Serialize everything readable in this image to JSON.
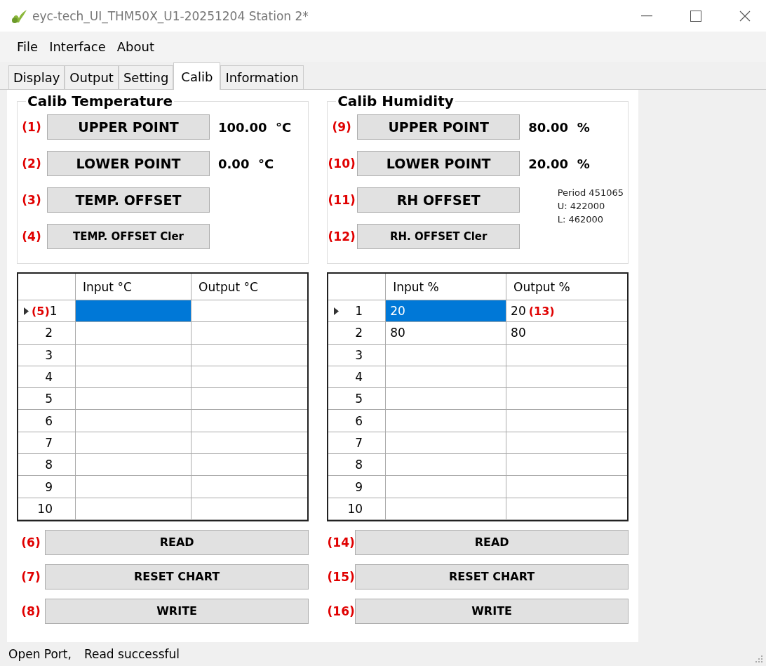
{
  "window": {
    "title": "eyc-tech_UI_THM50X_U1-20251204  Station 2*"
  },
  "menu": [
    {
      "label": "File"
    },
    {
      "label": "Interface"
    },
    {
      "label": "About"
    }
  ],
  "tabs": [
    {
      "label": "Display",
      "selected": false
    },
    {
      "label": "Output",
      "selected": false
    },
    {
      "label": "Setting",
      "selected": false
    },
    {
      "label": "Calib",
      "selected": true
    },
    {
      "label": "Information",
      "selected": false
    }
  ],
  "panels": [
    {
      "title": "Calib Temperature",
      "rows": [
        {
          "callout": "(1)",
          "button": "UPPER POINT",
          "kind": "large",
          "value": "100.00  °C"
        },
        {
          "callout": "(2)",
          "button": "LOWER POINT",
          "kind": "large",
          "value": "0.00  °C"
        },
        {
          "callout": "(3)",
          "button": "TEMP. OFFSET",
          "kind": "large"
        },
        {
          "callout": "(4)",
          "button": "TEMP. OFFSET Cler",
          "kind": "small"
        }
      ],
      "grid": {
        "columns": [
          "Input °C",
          "Output °C"
        ],
        "rows": [
          {
            "number": "1",
            "current": true,
            "callout": "(5)",
            "cells": [
              {
                "selected": true
              },
              {
                "selected": false
              }
            ]
          },
          {
            "number": "2",
            "current": false,
            "cells": [
              {
                "selected": false
              },
              {
                "selected": false
              }
            ]
          },
          {
            "number": "3",
            "current": false,
            "cells": [
              {
                "selected": false
              },
              {
                "selected": false
              }
            ]
          },
          {
            "number": "4",
            "current": false,
            "cells": [
              {
                "selected": false
              },
              {
                "selected": false
              }
            ]
          },
          {
            "number": "5",
            "current": false,
            "cells": [
              {
                "selected": false
              },
              {
                "selected": false
              }
            ]
          },
          {
            "number": "6",
            "current": false,
            "cells": [
              {
                "selected": false
              },
              {
                "selected": false
              }
            ]
          },
          {
            "number": "7",
            "current": false,
            "cells": [
              {
                "selected": false
              },
              {
                "selected": false
              }
            ]
          },
          {
            "number": "8",
            "current": false,
            "cells": [
              {
                "selected": false
              },
              {
                "selected": false
              }
            ]
          },
          {
            "number": "9",
            "current": false,
            "cells": [
              {
                "selected": false
              },
              {
                "selected": false
              }
            ]
          },
          {
            "number": "10",
            "current": false,
            "cells": [
              {
                "selected": false
              },
              {
                "selected": false
              }
            ]
          }
        ]
      },
      "actions": [
        {
          "callout": "(6)",
          "label": "READ"
        },
        {
          "callout": "(7)",
          "label": "RESET CHART"
        },
        {
          "callout": "(8)",
          "label": "WRITE"
        }
      ]
    },
    {
      "title": "Calib Humidity",
      "rows": [
        {
          "callout": "(9)",
          "button": "UPPER POINT",
          "kind": "large",
          "value": "80.00  %"
        },
        {
          "callout": "(10)",
          "button": "LOWER POINT",
          "kind": "large",
          "value": "20.00  %"
        },
        {
          "callout": "(11)",
          "button": "RH OFFSET",
          "kind": "large"
        },
        {
          "callout": "(12)",
          "button": "RH. OFFSET Cler",
          "kind": "small"
        }
      ],
      "notes": [
        "Period 451065",
        "U: 422000",
        "L: 462000"
      ],
      "grid": {
        "columns": [
          "Input %",
          "Output %"
        ],
        "rows": [
          {
            "number": "1",
            "current": true,
            "cells": [
              {
                "value": "20",
                "selected": true
              },
              {
                "value": "20",
                "selected": false,
                "callout": "(13)"
              }
            ]
          },
          {
            "number": "2",
            "current": false,
            "cells": [
              {
                "value": "80",
                "selected": false
              },
              {
                "value": "80",
                "selected": false
              }
            ]
          },
          {
            "number": "3",
            "current": false,
            "cells": [
              {
                "selected": false
              },
              {
                "selected": false
              }
            ]
          },
          {
            "number": "4",
            "current": false,
            "cells": [
              {
                "selected": false
              },
              {
                "selected": false
              }
            ]
          },
          {
            "number": "5",
            "current": false,
            "cells": [
              {
                "selected": false
              },
              {
                "selected": false
              }
            ]
          },
          {
            "number": "6",
            "current": false,
            "cells": [
              {
                "selected": false
              },
              {
                "selected": false
              }
            ]
          },
          {
            "number": "7",
            "current": false,
            "cells": [
              {
                "selected": false
              },
              {
                "selected": false
              }
            ]
          },
          {
            "number": "8",
            "current": false,
            "cells": [
              {
                "selected": false
              },
              {
                "selected": false
              }
            ]
          },
          {
            "number": "9",
            "current": false,
            "cells": [
              {
                "selected": false
              },
              {
                "selected": false
              }
            ]
          },
          {
            "number": "10",
            "current": false,
            "cells": [
              {
                "selected": false
              },
              {
                "selected": false
              }
            ]
          }
        ]
      },
      "actions": [
        {
          "callout": "(14)",
          "label": "READ"
        },
        {
          "callout": "(15)",
          "label": "RESET CHART"
        },
        {
          "callout": "(16)",
          "label": "WRITE"
        }
      ]
    }
  ],
  "status_bar": {
    "items": [
      "Open Port,",
      "Read successful"
    ]
  }
}
